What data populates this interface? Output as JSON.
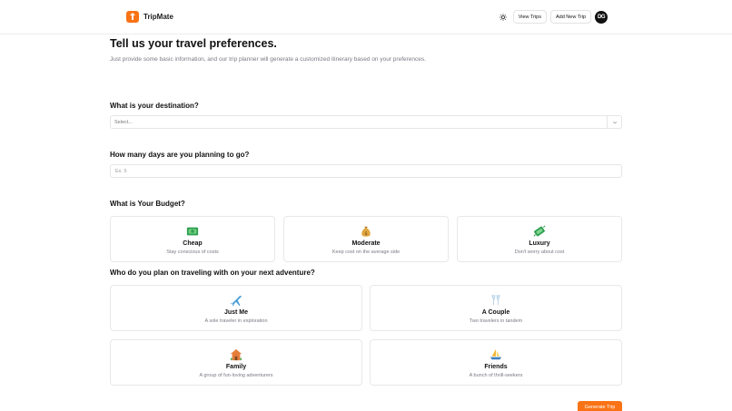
{
  "header": {
    "app_name": "TripMate",
    "view_trips": "View Trips",
    "add_new_trip": "Add New Trip",
    "avatar_initials": "DG",
    "brand_color": "#f97316"
  },
  "page": {
    "title": "Tell us your travel preferences.",
    "subtitle": "Just provide some basic information, and our trip planner will generate a customized itinerary based on your preferences."
  },
  "destination": {
    "question": "What is your destination?",
    "placeholder": "Select..."
  },
  "days": {
    "question": "How many days are you planning to go?",
    "placeholder": "Ex. 5"
  },
  "budget": {
    "question": "What is Your Budget?",
    "options": [
      {
        "title": "Cheap",
        "desc": "Stay conscious of costs",
        "icon": "money-bills-icon"
      },
      {
        "title": "Moderate",
        "desc": "Keep cost on the average side",
        "icon": "money-bag-icon"
      },
      {
        "title": "Luxury",
        "desc": "Don't worry about cost",
        "icon": "cash-flying-icon"
      }
    ]
  },
  "travelers": {
    "question": "Who do you plan on traveling with on your next adventure?",
    "options": [
      {
        "title": "Just Me",
        "desc": "A sole traveler in exploration",
        "icon": "airplane-icon"
      },
      {
        "title": "A Couple",
        "desc": "Two travelers in tandem",
        "icon": "champagne-glasses-icon"
      },
      {
        "title": "Family",
        "desc": "A group of fun-loving adventurers",
        "icon": "house-icon"
      },
      {
        "title": "Friends",
        "desc": "A bunch of thrill-seekers",
        "icon": "sailboat-icon"
      }
    ]
  },
  "actions": {
    "generate": "Generate Trip"
  }
}
